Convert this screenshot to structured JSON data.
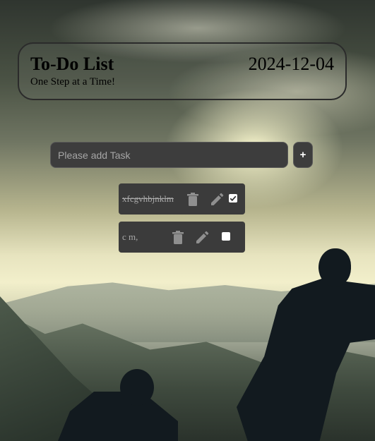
{
  "header": {
    "title": "To-Do List",
    "subtitle": "One Step at a Time!",
    "date": "2024-12-04"
  },
  "add_task": {
    "placeholder": "Please add Task",
    "value": "",
    "button_label": "+"
  },
  "tasks": [
    {
      "text": "xfcgvhbjnklm",
      "completed": true,
      "delete_icon": "trash-icon",
      "edit_icon": "pencil-icon"
    },
    {
      "text": "c m,",
      "completed": false,
      "delete_icon": "trash-icon",
      "edit_icon": "pencil-icon"
    }
  ],
  "colors": {
    "card_bg": "#3b3b3b",
    "input_bg": "#3d3d3d",
    "icon": "#8f8f8f",
    "text_muted": "#a8a8a8"
  }
}
